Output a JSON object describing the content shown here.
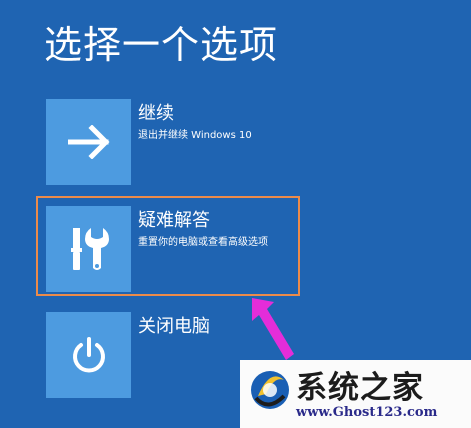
{
  "page": {
    "title": "选择一个选项"
  },
  "options": [
    {
      "label": "继续",
      "description": "退出并继续 Windows 10",
      "icon": "arrow-right-icon"
    },
    {
      "label": "疑难解答",
      "description": "重置你的电脑或查看高级选项",
      "icon": "tools-icon"
    },
    {
      "label": "关闭电脑",
      "description": "",
      "icon": "power-icon"
    }
  ],
  "watermark": {
    "name": "系统之家",
    "url": "www.Ghost123.com"
  },
  "colors": {
    "background": "#1f64b2",
    "tile": "#4d9be0",
    "highlight": "#ec8b4a",
    "pointer": "#e42dd9"
  }
}
